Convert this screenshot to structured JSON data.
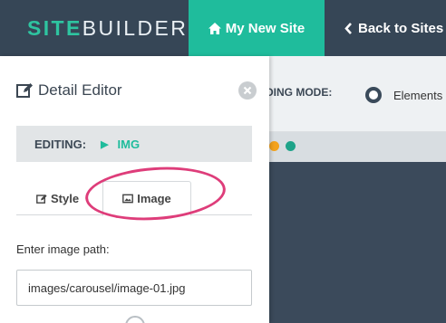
{
  "topbar": {
    "logo_accent": "SITE",
    "logo_rest": "BUILDER",
    "site_label": "My New Site",
    "back_label": "Back to Sites"
  },
  "mode_bar": {
    "label": "DING MODE:",
    "option_label": "Elements"
  },
  "panel": {
    "title": "Detail Editor",
    "editing_label": "EDITING:",
    "editing_target": "IMG",
    "tabs": [
      {
        "label": "Style",
        "icon": "edit-icon"
      },
      {
        "label": "Image",
        "icon": "image-icon",
        "active": true
      }
    ],
    "field_label": "Enter image path:",
    "image_path": "images/carousel/image-01.jpg"
  },
  "colors": {
    "accent": "#1fbc9c",
    "navbar": "#364656",
    "highlight": "#de3d7a",
    "dot_orange": "#f3a21c",
    "dot_green": "#1ea389"
  }
}
